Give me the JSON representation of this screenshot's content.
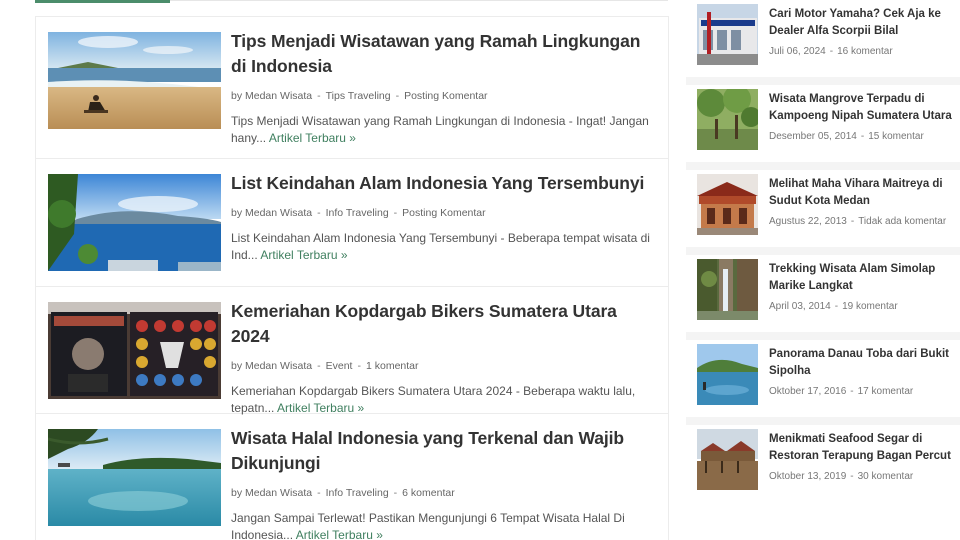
{
  "posts": [
    {
      "title": "Tips Menjadi Wisatawan yang Ramah Lingkungan di Indonesia",
      "author": "by Medan Wisata",
      "category": "Tips Traveling",
      "comments": "Posting Komentar",
      "excerpt": "Tips Menjadi Wisatawan yang Ramah Lingkungan di Indonesia - Ingat! Jangan hany...",
      "more": "Artikel Terbaru »",
      "thumb_icon": "beach-photo"
    },
    {
      "title": "List Keindahan Alam Indonesia Yang Tersembunyi",
      "author": "by Medan Wisata",
      "category": "Info Traveling",
      "comments": "Posting Komentar",
      "excerpt": "List Keindahan Alam Indonesia Yang Tersembunyi - Beberapa tempat wisata di Ind...",
      "more": "Artikel Terbaru »",
      "thumb_icon": "lake-photo"
    },
    {
      "title": "Kemeriahan Kopdargab Bikers Sumatera Utara 2024",
      "author": "by Medan Wisata",
      "category": "Event",
      "comments": "1 komentar",
      "excerpt": "Kemeriahan Kopdargab Bikers Sumatera Utara 2024 -  Beberapa waktu lalu, tepatn...",
      "more": "Artikel Terbaru »",
      "thumb_icon": "bikers-banner-photo"
    },
    {
      "title": "Wisata Halal Indonesia yang Terkenal dan Wajib Dikunjungi",
      "author": "by Medan Wisata",
      "category": "Info Traveling",
      "comments": "6 komentar",
      "excerpt": "Jangan Sampai Terlewat! Pastikan Mengunjungi 6 Tempat Wisata Halal Di Indonesia...",
      "more": "Artikel Terbaru »",
      "thumb_icon": "sea-photo"
    }
  ],
  "sidebar": {
    "items": [
      {
        "title": "Cari Motor Yamaha? Cek Aja ke Dealer Alfa Scorpii Bilal",
        "date": "Juli 06, 2024",
        "comments": "16 komentar",
        "thumb_icon": "dealer-photo"
      },
      {
        "title": "Wisata Mangrove Terpadu di Kampoeng Nipah Sumatera Utara",
        "date": "Desember 05, 2014",
        "comments": "15 komentar",
        "thumb_icon": "mangrove-photo"
      },
      {
        "title": "Melihat Maha Vihara Maitreya di Sudut Kota Medan",
        "date": "Agustus 22, 2013",
        "comments": "Tidak ada komentar",
        "thumb_icon": "temple-photo"
      },
      {
        "title": "Trekking Wisata Alam Simolap Marike Langkat",
        "date": "April 03, 2014",
        "comments": "19 komentar",
        "thumb_icon": "waterfall-photo"
      },
      {
        "title": "Panorama Danau Toba dari Bukit Sipolha",
        "date": "Oktober 17, 2016",
        "comments": "17 komentar",
        "thumb_icon": "toba-photo"
      },
      {
        "title": "Menikmati Seafood Segar di Restoran Terapung Bagan Percut",
        "date": "Oktober 13, 2019",
        "comments": "30 komentar",
        "thumb_icon": "floating-restaurant-photo"
      }
    ]
  }
}
